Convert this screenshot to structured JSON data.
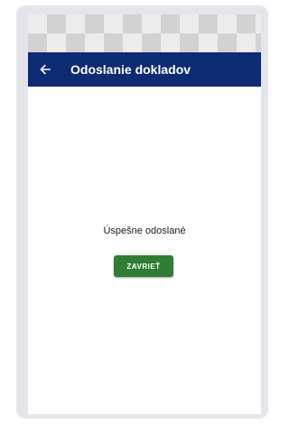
{
  "app_bar": {
    "back_icon": "arrow-left-icon",
    "title": "Odoslanie dokladov"
  },
  "content": {
    "message": "Úspešne odoslané",
    "close_button": "ZAVRIEŤ"
  },
  "colors": {
    "app_bar": "#0f2a75",
    "primary_button": "#2f7d35",
    "frame": "#e3e5ea"
  }
}
